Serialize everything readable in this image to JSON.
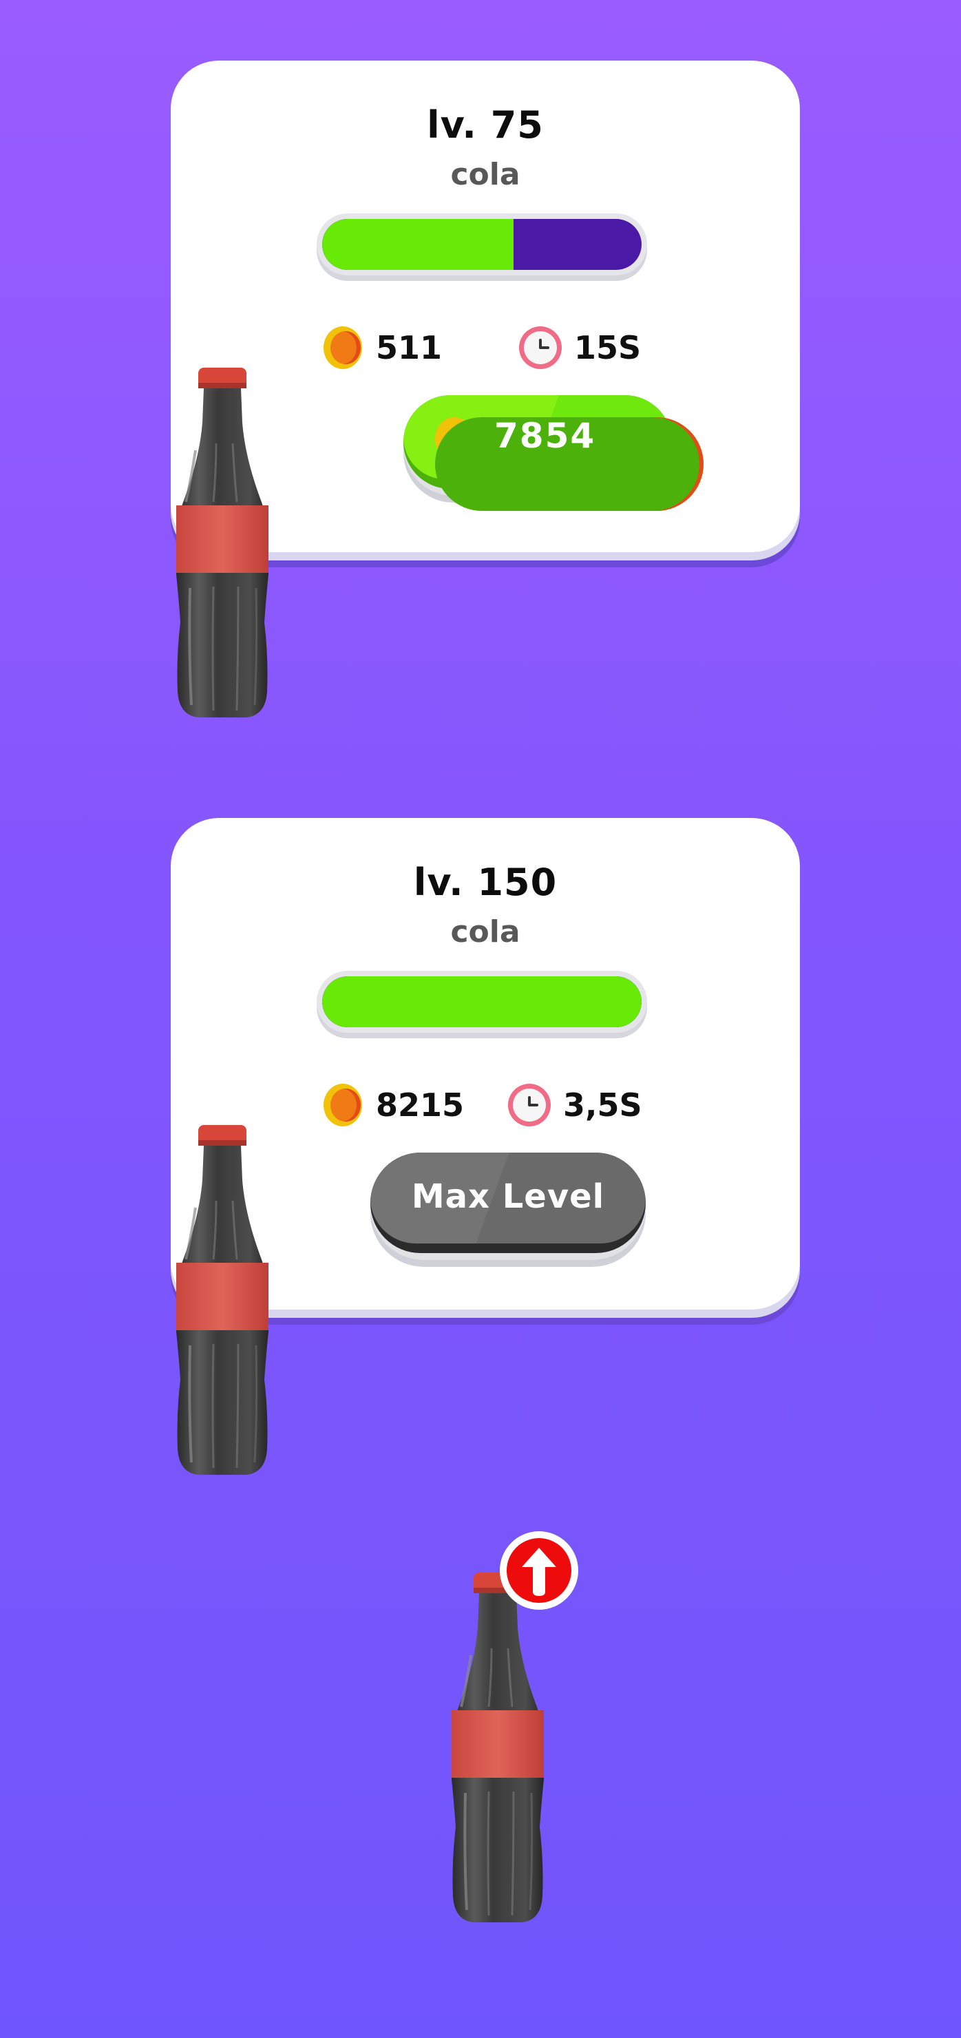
{
  "cards": [
    {
      "level": "lv. 75",
      "name": "cola",
      "progress": 0.6,
      "coins": "511",
      "time": "15S",
      "button_label": "7854",
      "button_state": "buy"
    },
    {
      "level": "lv. 150",
      "name": "cola",
      "progress": 1.0,
      "coins": "8215",
      "time": "3,5S",
      "button_label": "Max Level",
      "button_state": "max"
    }
  ],
  "icons": {
    "coin": "coin-icon",
    "timer": "clock-icon",
    "upgrade": "arrow-up-icon",
    "item": "cola-bottle"
  },
  "colors": {
    "background_top": "#9a5cfe",
    "background_bottom": "#6f56fc",
    "progress_fill": "#68ea07",
    "progress_track": "#4a1aa6",
    "buy_button": "#86f012",
    "max_button": "#747474",
    "upgrade_badge": "#ee0b0b"
  }
}
